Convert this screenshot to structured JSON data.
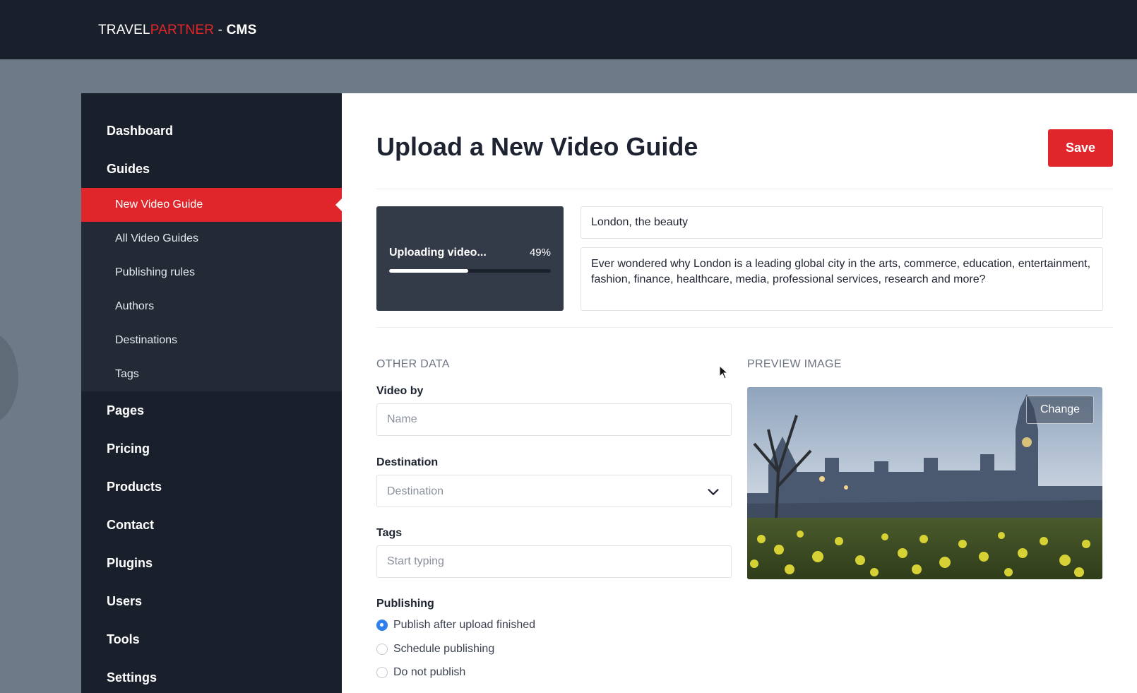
{
  "brand": {
    "part1": "TRAVEL",
    "part2": "PARTNER",
    "part3": " - ",
    "part4": "CMS"
  },
  "sidebar": {
    "items_top": [
      {
        "label": "Dashboard"
      },
      {
        "label": "Guides"
      }
    ],
    "subitems": [
      {
        "label": "New Video Guide",
        "active": true
      },
      {
        "label": "All Video Guides"
      },
      {
        "label": "Publishing rules"
      },
      {
        "label": "Authors"
      },
      {
        "label": "Destinations"
      },
      {
        "label": "Tags"
      }
    ],
    "items_bottom": [
      {
        "label": "Pages"
      },
      {
        "label": "Pricing"
      },
      {
        "label": "Products"
      },
      {
        "label": "Contact"
      },
      {
        "label": "Plugins"
      },
      {
        "label": "Users"
      },
      {
        "label": "Tools"
      },
      {
        "label": "Settings"
      }
    ]
  },
  "main": {
    "title": "Upload a New Video Guide",
    "save_label": "Save",
    "upload": {
      "label": "Uploading video...",
      "percent_text": "49%",
      "progress": 0.49
    },
    "video_title": "London, the beauty",
    "video_description": "Ever wondered why London is a leading global city in the arts, commerce, education, entertainment, fashion, finance, healthcare, media, professional services, research and more?",
    "other_data_label": "OTHER DATA",
    "preview_label": "PREVIEW IMAGE",
    "video_by": {
      "label": "Video by",
      "placeholder": "Name"
    },
    "destination": {
      "label": "Destination",
      "placeholder": "Destination"
    },
    "tags": {
      "label": "Tags",
      "placeholder": "Start typing"
    },
    "publishing": {
      "label": "Publishing",
      "options": [
        {
          "label": "Publish after upload finished",
          "checked": true
        },
        {
          "label": "Schedule publishing",
          "checked": false
        },
        {
          "label": "Do not publish",
          "checked": false
        }
      ]
    },
    "change_label": "Change"
  },
  "colors": {
    "accent": "#e0262b",
    "sidebar": "#1a202b",
    "radio_checked": "#2f80ed"
  }
}
